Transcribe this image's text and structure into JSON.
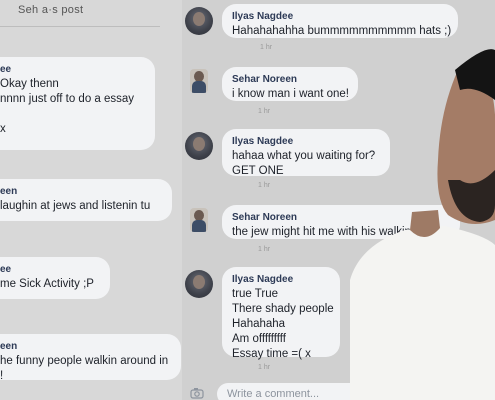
{
  "header": {
    "title": "Seh a·s post"
  },
  "left_messages": [
    {
      "name": "ee",
      "lines": [
        "Okay thenn",
        "nnnn just off to do a essay",
        "",
        "x"
      ]
    },
    {
      "name": "een",
      "lines": [
        "laughin at jews and listenin tu"
      ]
    },
    {
      "name": "ee",
      "lines": [
        "me Sick Activity ;P"
      ]
    },
    {
      "name": "een",
      "lines": [
        "he funny people walkin around in",
        "!"
      ]
    }
  ],
  "right_messages": [
    {
      "author": "Ilyas Nagdee",
      "lines": [
        "Hahahahahha bummmmmmmmmm hats ;)"
      ],
      "time": "1 hr"
    },
    {
      "author": "Sehar Noreen",
      "lines": [
        "i know man i want one!"
      ],
      "time": "1 hr"
    },
    {
      "author": "Ilyas Nagdee",
      "lines": [
        "hahaa what you waiting for?",
        "GET ONE"
      ],
      "time": "1 hr"
    },
    {
      "author": "Sehar Noreen",
      "lines": [
        "the jew might hit me with his walking stick"
      ],
      "time": "1 hr"
    },
    {
      "author": "Ilyas Nagdee",
      "lines": [
        "true True",
        "There shady people",
        "Hahahaha",
        "Am offfffffff",
        "Essay time =( x"
      ],
      "time": "1 hr"
    }
  ],
  "comment": {
    "placeholder": "Write a comment..."
  },
  "colors": {
    "bubble": "#f2f3f5",
    "name": "#2d3a56",
    "background": "#d0d0d0"
  }
}
